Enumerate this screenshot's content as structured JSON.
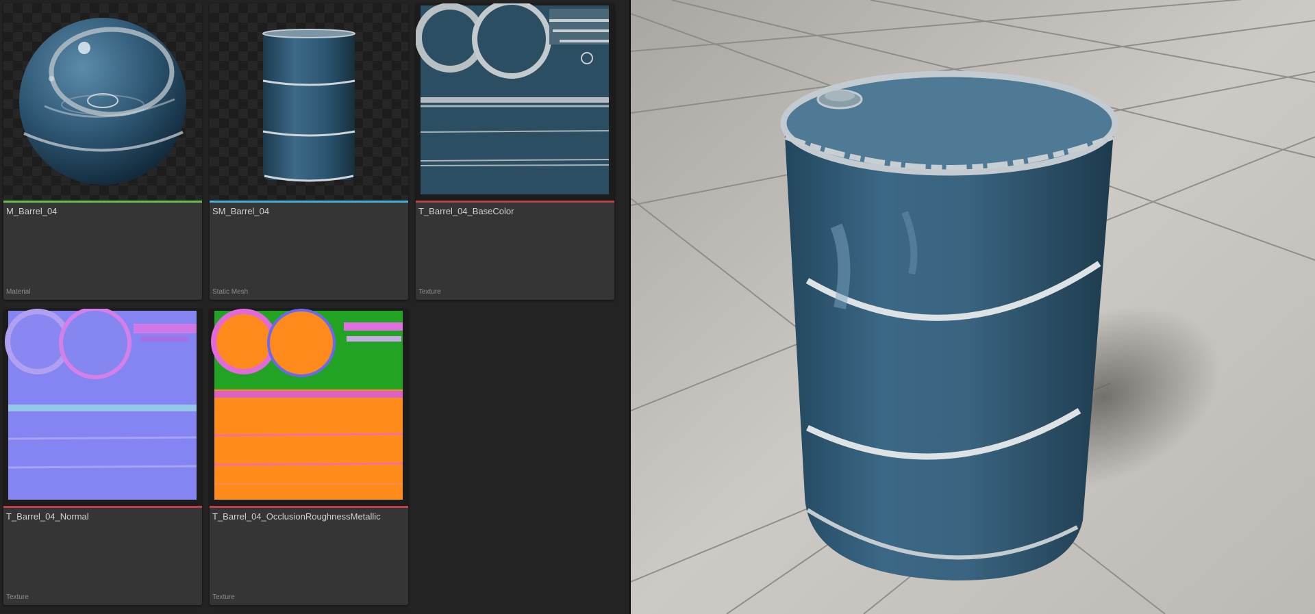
{
  "assets": [
    {
      "name": "M_Barrel_04",
      "type": "Material",
      "type_color": "#6bc24a"
    },
    {
      "name": "SM_Barrel_04",
      "type": "Static Mesh",
      "type_color": "#3fb5d9"
    },
    {
      "name": "T_Barrel_04_BaseColor",
      "type": "Texture",
      "type_color": "#c0404a"
    },
    {
      "name": "T_Barrel_04_Normal",
      "type": "Texture",
      "type_color": "#c0404a"
    },
    {
      "name": "T_Barrel_04_OcclusionRoughnessMetallic",
      "type": "Texture",
      "type_color": "#c0404a"
    }
  ],
  "viewport": {
    "subject": "barrel-mesh-preview",
    "barrel_color": "#3a6580",
    "floor_color": "#c9c4c0"
  }
}
